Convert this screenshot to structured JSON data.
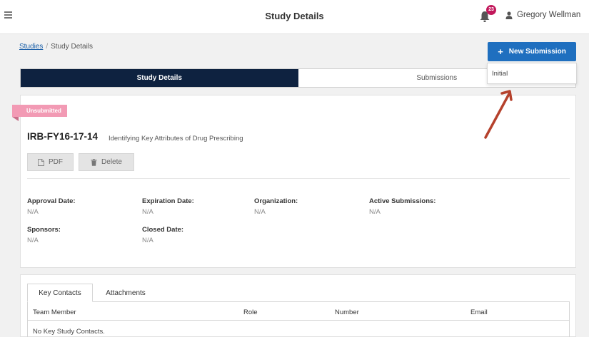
{
  "header": {
    "title": "Study Details",
    "notification_count": "23",
    "user_name": "Gregory Wellman"
  },
  "breadcrumb": {
    "studies": "Studies",
    "separator": "/",
    "current": "Study Details"
  },
  "new_submission": {
    "label": "New Submission",
    "menu_items": [
      "Initial"
    ]
  },
  "tabs": [
    "Study Details",
    "Submissions"
  ],
  "study": {
    "status": "Unsubmitted",
    "id": "IRB-FY16-17-14",
    "title": "Identifying Key Attributes of Drug Prescribing",
    "pdf_label": "PDF",
    "delete_label": "Delete",
    "fields": {
      "approval_date": {
        "label": "Approval Date:",
        "value": "N/A"
      },
      "expiration_date": {
        "label": "Expiration Date:",
        "value": "N/A"
      },
      "organization": {
        "label": "Organization:",
        "value": "N/A"
      },
      "active_submissions": {
        "label": "Active Submissions:",
        "value": "N/A"
      },
      "sponsors": {
        "label": "Sponsors:",
        "value": "N/A"
      },
      "closed_date": {
        "label": "Closed Date:",
        "value": "N/A"
      }
    }
  },
  "contacts": {
    "tabs": [
      "Key Contacts",
      "Attachments"
    ],
    "columns": [
      "Team Member",
      "Role",
      "Number",
      "Email"
    ],
    "empty_text": "No Key Study Contacts."
  },
  "colors": {
    "primary_button": "#1f6fbf",
    "active_tab": "#0e2240",
    "status_badge": "#f29ab4",
    "notification_badge": "#c2185b",
    "annotation_arrow": "#b5412c"
  },
  "icons": {
    "menu": "hamburger-icon",
    "notifications": "bell-icon",
    "user": "user-icon",
    "add": "plus-icon",
    "pdf": "file-icon",
    "delete": "trash-icon"
  }
}
